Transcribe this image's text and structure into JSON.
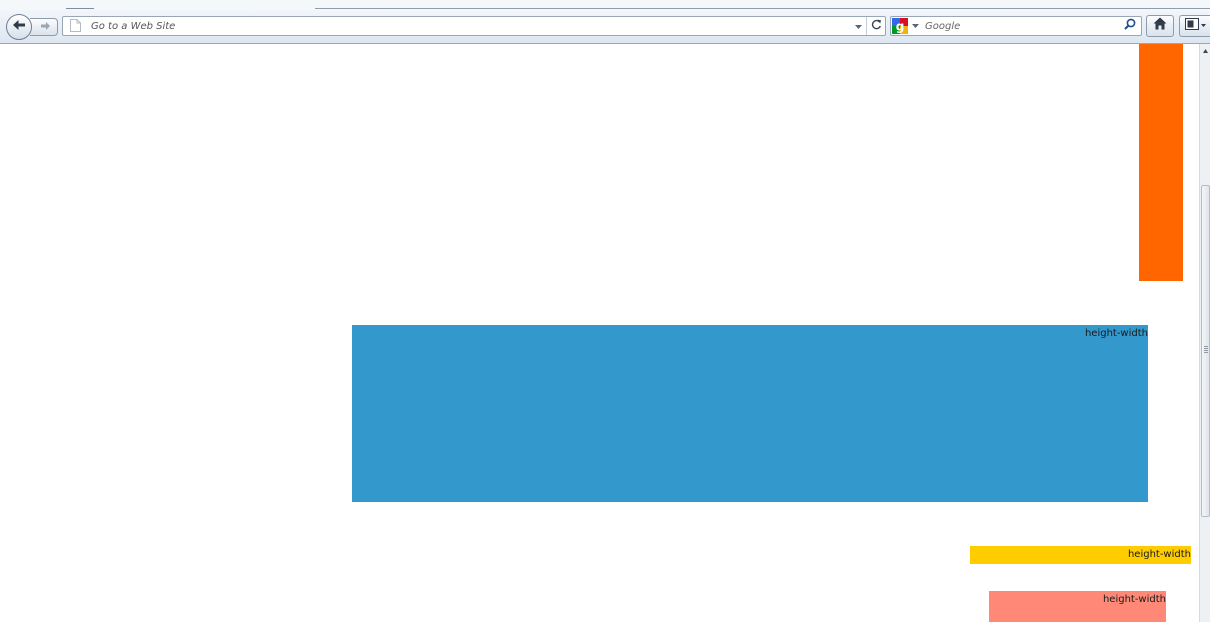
{
  "browser": {
    "address_bar": {
      "placeholder": "Go to a Web Site",
      "value": "",
      "page_icon": "blank-page-icon",
      "dropdown_icon": "chevron-down-icon",
      "reload_icon": "reload-icon"
    },
    "search_bar": {
      "placeholder": "Google",
      "value": "",
      "engine": "Google",
      "go_icon": "magnifier-icon"
    },
    "buttons": {
      "back_icon": "arrow-left-icon",
      "forward_icon": "arrow-right-icon",
      "home_icon": "home-icon",
      "bookmarks_icon": "bookmarks-icon"
    }
  },
  "page": {
    "boxes": [
      {
        "id": "orange",
        "label": "",
        "color": "#ff6600"
      },
      {
        "id": "blue",
        "label": "height-width",
        "color": "#3399cc"
      },
      {
        "id": "yellow",
        "label": "height-width",
        "color": "#ffcc00"
      },
      {
        "id": "salmon",
        "label": "height-width",
        "color": "#ff8877"
      }
    ]
  },
  "colors": {
    "toolbar_top": "#f2f6fb",
    "toolbar_bottom": "#dde6f0",
    "border": "#98a6b6"
  }
}
